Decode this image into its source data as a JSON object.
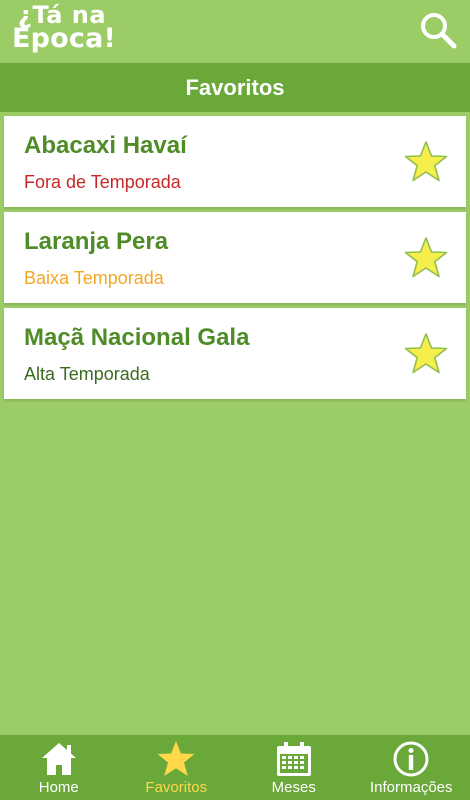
{
  "app": {
    "logo_line1": "¿Tá na",
    "logo_line2": "Época!"
  },
  "header": {
    "title": "Favoritos",
    "search_icon": "search-icon"
  },
  "favorites": [
    {
      "name": "Abacaxi Havaí",
      "status": "Fora de Temporada",
      "status_color": "#c62828"
    },
    {
      "name": "Laranja Pera",
      "status": "Baixa Temporada",
      "status_color": "#f5a623"
    },
    {
      "name": "Maçã Nacional Gala",
      "status": "Alta Temporada",
      "status_color": "#3a6b1e"
    }
  ],
  "bottom_nav": [
    {
      "label": "Home",
      "icon": "home-icon",
      "active": false
    },
    {
      "label": "Favoritos",
      "icon": "star-icon",
      "active": true
    },
    {
      "label": "Meses",
      "icon": "calendar-icon",
      "active": false
    },
    {
      "label": "Informações",
      "icon": "info-icon",
      "active": false
    }
  ],
  "colors": {
    "background": "#9ccc65",
    "bar": "#6aa83a",
    "accent": "#ffd84a",
    "star_fill": "#f6ee4a"
  }
}
